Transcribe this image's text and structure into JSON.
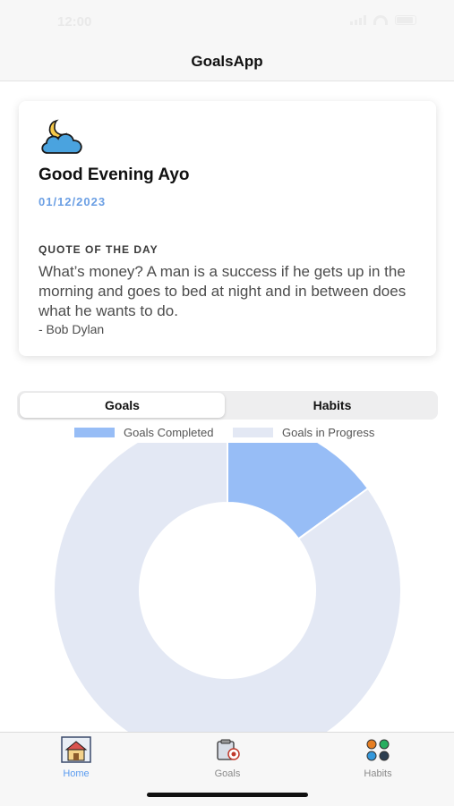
{
  "status": {
    "time": "12:00"
  },
  "nav": {
    "title": "GoalsApp"
  },
  "card": {
    "greeting": "Good Evening Ayo",
    "date": "01/12/2023",
    "quote_label": "QUOTE OF THE DAY",
    "quote_text": "What’s money? A man is a success if he gets up in the morning and goes to bed at night and in between does what he wants to do.",
    "quote_author": "- Bob Dylan",
    "icon": "moon-cloud-icon"
  },
  "segmented": {
    "goals_label": "Goals",
    "habits_label": "Habits",
    "selected": "Goals"
  },
  "chart_data": {
    "type": "pie",
    "donut": true,
    "categories": [
      "Goals Completed",
      "Goals in Progress"
    ],
    "values": [
      15,
      85
    ],
    "colors": [
      "#97bdf6",
      "#e3e8f4"
    ],
    "legend_placement": "top",
    "start_angle_deg": 0,
    "direction": "clockwise"
  },
  "tabs": [
    {
      "label": "Home",
      "icon": "home-icon",
      "active": true
    },
    {
      "label": "Goals",
      "icon": "goals-icon",
      "active": false
    },
    {
      "label": "Habits",
      "icon": "habits-icon",
      "active": false
    }
  ],
  "colors": {
    "accent": "#5b9cf0",
    "date": "#6b9fe4"
  }
}
